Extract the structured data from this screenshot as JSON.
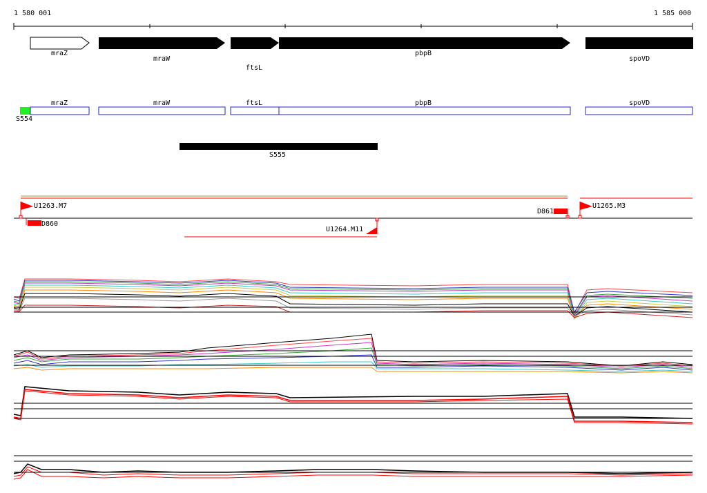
{
  "coord_start": "1 580 001",
  "coord_end": "1 585 000",
  "genes": [
    {
      "name": "mraZ"
    },
    {
      "name": "mraW"
    },
    {
      "name": "ftsL"
    },
    {
      "name": "pbpB"
    },
    {
      "name": "spoVD"
    }
  ],
  "region_labels": {
    "s554": "S554",
    "s555": "S555",
    "u1263": "U1263.M7",
    "u1264": "U1264.M11",
    "u1265": "U1265.M3",
    "d860": "D860",
    "d861": "D861"
  },
  "colors": {
    "annotation_box": "#2222cc",
    "s554": "#22ee22",
    "feature_red": "#ff0000",
    "olive_line": "#999933"
  }
}
